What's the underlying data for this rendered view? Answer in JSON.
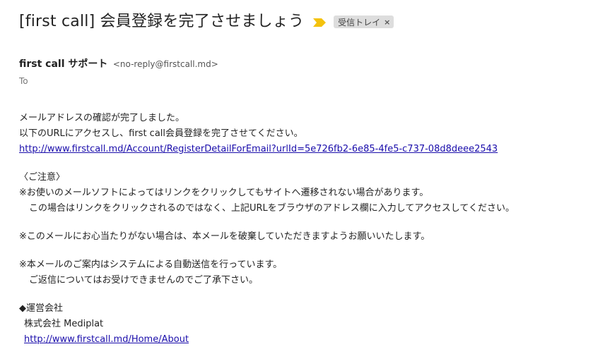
{
  "subject": {
    "title": "[first call] 会員登録を完了させましょう",
    "label": "受信トレイ",
    "label_close": "×"
  },
  "sender": {
    "name": "first call サポート",
    "email": "<no-reply@firstcall.md>"
  },
  "recipient": {
    "to_label": "To"
  },
  "body": {
    "line1": "メールアドレスの確認が完了しました。",
    "line2": "以下のURLにアクセスし、first call会員登録を完了させてください。",
    "register_link": "http://www.firstcall.md/Account/RegisterDetailForEmail?urlId=5e726fb2-6e85-4fe5-c737-08d8deee2543",
    "notice_heading": "〈ご注意〉",
    "notice1": "※お使いのメールソフトによってはリンクをクリックしてもサイトへ遷移されない場合があります。",
    "notice1_cont": "この場合はリンクをクリックされるのではなく、上記URLをブラウザのアドレス欄に入力してアクセスしてください。",
    "notice2": "※このメールにお心当たりがない場合は、本メールを破棄していただきますようお願いいたします。",
    "notice3": "※本メールのご案内はシステムによる自動送信を行っています。",
    "notice3_cont": "ご返信についてはお受けできませんのでご了承下さい。",
    "company_heading": "◆運営会社",
    "company_name": "株式会社 Mediplat",
    "company_link": "http://www.firstcall.md/Home/About"
  },
  "colors": {
    "importance_marker": "#f4c20d",
    "link": "#1a0dab",
    "label_bg": "#dddddd"
  },
  "icons": {
    "importance": "importance-marker-icon",
    "label_close": "close-icon"
  }
}
